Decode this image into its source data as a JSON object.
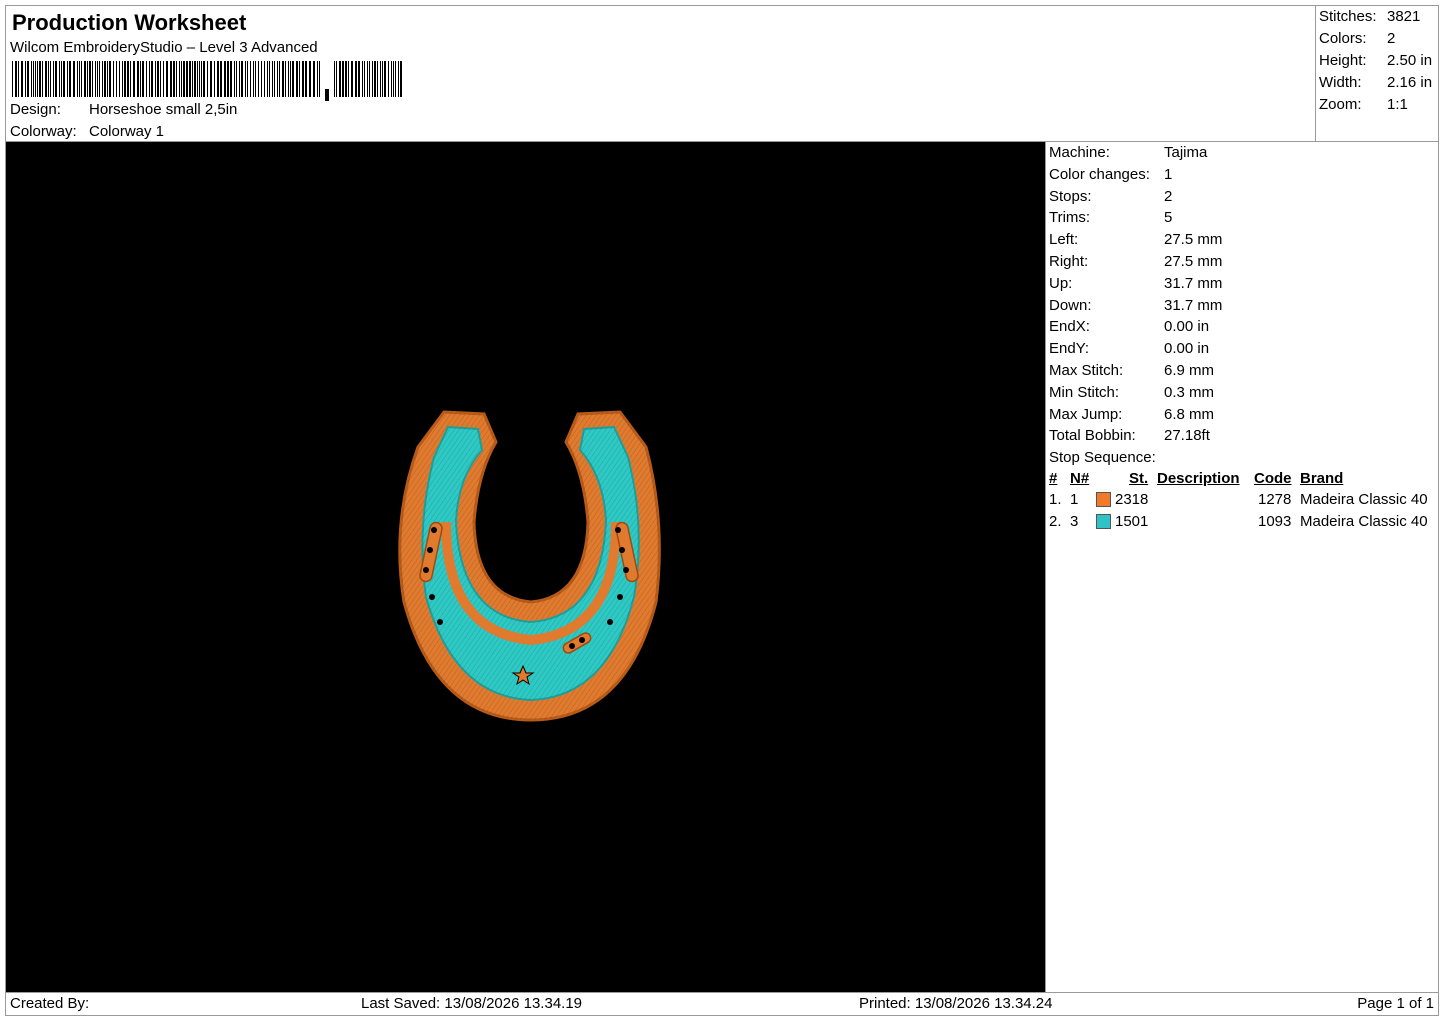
{
  "header": {
    "title": "Production Worksheet",
    "subtitle": "Wilcom EmbroideryStudio – Level 3 Advanced",
    "design_label": "Design:",
    "design_value": "Horseshoe small 2,5in",
    "colorway_label": "Colorway:",
    "colorway_value": "Colorway 1"
  },
  "summary": [
    {
      "label": "Stitches:",
      "value": "3821"
    },
    {
      "label": "Colors:",
      "value": "2"
    },
    {
      "label": "Height:",
      "value": "2.50 in"
    },
    {
      "label": "Width:",
      "value": "2.16 in"
    },
    {
      "label": "Zoom:",
      "value": "1:1"
    }
  ],
  "details": [
    {
      "label": "Machine:",
      "value": "Tajima"
    },
    {
      "label": "Color changes:",
      "value": "1"
    },
    {
      "label": "Stops:",
      "value": "2"
    },
    {
      "label": "Trims:",
      "value": "5"
    },
    {
      "label": "Left:",
      "value": "27.5 mm"
    },
    {
      "label": "Right:",
      "value": "27.5 mm"
    },
    {
      "label": "Up:",
      "value": "31.7 mm"
    },
    {
      "label": "Down:",
      "value": "31.7 mm"
    },
    {
      "label": "EndX:",
      "value": "0.00 in"
    },
    {
      "label": "EndY:",
      "value": "0.00 in"
    },
    {
      "label": "Max Stitch:",
      "value": "6.9 mm"
    },
    {
      "label": "Min Stitch:",
      "value": "0.3 mm"
    },
    {
      "label": "Max Jump:",
      "value": "6.8 mm"
    },
    {
      "label": "Total Bobbin:",
      "value": "27.18ft"
    },
    {
      "label": "Stop Sequence:",
      "value": ""
    }
  ],
  "sequence": {
    "columns": [
      "#",
      "N#",
      "St.",
      "Description",
      "Code",
      "Brand"
    ],
    "rows": [
      {
        "idx": "1.",
        "needle": "1",
        "color": "#f07a2a",
        "stitches": "2318",
        "description": "",
        "code": "1278",
        "brand": "Madeira Classic 40"
      },
      {
        "idx": "2.",
        "needle": "3",
        "color": "#2fc3c5",
        "stitches": "1501",
        "description": "",
        "code": "1093",
        "brand": "Madeira Classic 40"
      }
    ]
  },
  "footer": {
    "created_by": "Created By:",
    "last_saved": "Last Saved: 13/08/2026 13.34.19",
    "printed": "Printed: 13/08/2026 13.34.24",
    "page": "Page 1 of 1"
  },
  "colors": {
    "thread_orange": "#e07a2e",
    "thread_teal": "#2ec9c4",
    "canvas_bg": "#000000"
  }
}
